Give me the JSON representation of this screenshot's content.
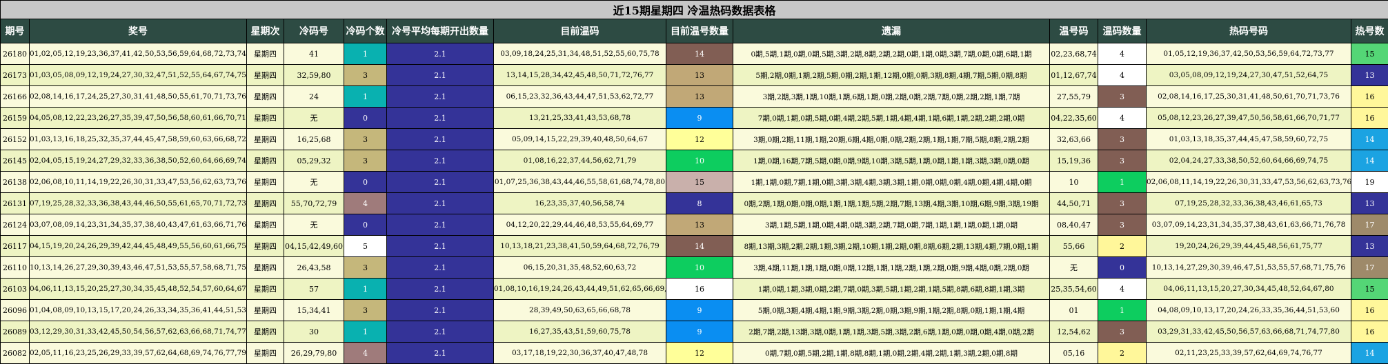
{
  "title": "近15期星期四 冷温热码数据表格",
  "headers": [
    "期号",
    "奖号",
    "星期次",
    "冷码号",
    "冷码个数",
    "冷号平均每期开出数量",
    "目前温码",
    "目前温号数量",
    "遗漏",
    "温号码",
    "温码数量",
    "热码号码",
    "热号数"
  ],
  "colors": {
    "avg": "#343398",
    "teal": "#09b1b0",
    "khaki": "#c5b77b",
    "navy": "#343398",
    "rose": "#9f7b7b",
    "white": "#ffffff",
    "brown": "#815e54",
    "tan": "#c1a877",
    "blue": "#0a8ef2",
    "yellow": "#ffff99",
    "green": "#0dcd5f",
    "pink": "#c9b0ab",
    "darkblue": "#343398",
    "lgreen": "#54d676",
    "skyblue": "#1ba3e2",
    "lyellow": "#fff79a",
    "taupe": "#9e8a6a"
  },
  "rows": [
    {
      "id": "26180",
      "nums": "01,02,05,12,19,23,36,37,41,42,50,53,56,59,64,68,72,73,74,77",
      "day": "星期四",
      "cold": "41",
      "cold_count": "1",
      "cold_color": "teal",
      "avg": "2.1",
      "warm": "03,09,18,24,25,31,34,48,51,52,55,60,75,78",
      "warm_count": "14",
      "warm_color": "brown",
      "miss": "0期,5期,1期,0期,0期,5期,3期,2期,8期,2期,2期,0期,1期,0期,3期,7期,0期,0期,6期,1期",
      "warm_nums": "02,23,68,74",
      "warm_num_count": "4",
      "warm_num_color": "white",
      "hot": "01,05,12,19,36,37,42,50,53,56,59,64,72,73,77",
      "hot_count": "15",
      "hot_color": "lgreen"
    },
    {
      "id": "26173",
      "nums": "01,03,05,08,09,12,19,24,27,30,32,47,51,52,55,64,67,74,75,80",
      "day": "星期四",
      "cold": "32,59,80",
      "cold_count": "3",
      "cold_color": "khaki",
      "avg": "2.1",
      "warm": "13,14,15,28,34,42,45,48,50,71,72,76,77",
      "warm_count": "13",
      "warm_color": "tan",
      "miss": "5期,2期,0期,1期,2期,5期,0期,2期,1期,12期,0期,0期,3期,8期,4期,7期,5期,0期,8期",
      "warm_nums": "01,12,67,74",
      "warm_num_count": "4",
      "warm_num_color": "white",
      "hot": "03,05,08,09,12,19,24,27,30,47,51,52,64,75",
      "hot_count": "13",
      "hot_color": "navy"
    },
    {
      "id": "26166",
      "nums": "02,08,14,16,17,24,25,27,30,31,41,48,50,55,61,70,71,73,76,79",
      "day": "星期四",
      "cold": "24",
      "cold_count": "1",
      "cold_color": "teal",
      "avg": "2.1",
      "warm": "06,15,23,32,36,43,44,47,51,53,62,72,77",
      "warm_count": "13",
      "warm_color": "tan",
      "miss": "3期,2期,3期,1期,10期,1期,6期,1期,0期,2期,0期,2期,7期,0期,2期,2期,1期,7期",
      "warm_nums": "27,55,79",
      "warm_num_count": "3",
      "warm_num_color": "brown",
      "hot": "02,08,14,16,17,25,30,31,41,48,50,61,70,71,73,76",
      "hot_count": "16",
      "hot_color": "lyellow"
    },
    {
      "id": "26159",
      "nums": "04,05,08,12,22,23,26,27,35,39,47,50,56,58,60,61,66,70,71,77",
      "day": "星期四",
      "cold": "无",
      "cold_count": "0",
      "cold_color": "navy",
      "avg": "2.1",
      "warm": "13,21,25,33,41,43,53,68,78",
      "warm_count": "9",
      "warm_color": "blue",
      "miss": "7期,0期,1期,0期,5期,0期,4期,2期,5期,1期,4期,4期,1期,6期,1期,2期,2期,2期,0期",
      "warm_nums": "04,22,35,60",
      "warm_num_count": "4",
      "warm_num_color": "white",
      "hot": "05,08,12,23,26,27,39,47,50,56,58,61,66,70,71,77",
      "hot_count": "16",
      "hot_color": "lyellow"
    },
    {
      "id": "26152",
      "nums": "01,03,13,16,18,25,32,35,37,44,45,47,58,59,60,63,66,68,72,75",
      "day": "星期四",
      "cold": "16,25,68",
      "cold_count": "3",
      "cold_color": "khaki",
      "avg": "2.1",
      "warm": "05,09,14,15,22,29,39,40,48,50,64,67",
      "warm_count": "12",
      "warm_color": "yellow",
      "miss": "3期,0期,2期,11期,1期,20期,6期,4期,0期,0期,2期,2期,1期,1期,7期,5期,8期,2期,2期",
      "warm_nums": "32,63,66",
      "warm_num_count": "3",
      "warm_num_color": "brown",
      "hot": "01,03,13,18,35,37,44,45,47,58,59,60,72,75",
      "hot_count": "14",
      "hot_color": "skyblue"
    },
    {
      "id": "26145",
      "nums": "02,04,05,15,19,24,27,29,32,33,36,38,50,52,60,64,66,69,74,75",
      "day": "星期四",
      "cold": "05,29,32",
      "cold_count": "3",
      "cold_color": "khaki",
      "avg": "2.1",
      "warm": "01,08,16,22,37,44,56,62,71,79",
      "warm_count": "10",
      "warm_color": "green",
      "miss": "1期,0期,16期,7期,5期,0期,0期,9期,10期,3期,5期,1期,0期,1期,1期,3期,3期,0期,0期",
      "warm_nums": "15,19,36",
      "warm_num_count": "3",
      "warm_num_color": "brown",
      "hot": "02,04,24,27,33,38,50,52,60,64,66,69,74,75",
      "hot_count": "14",
      "hot_color": "skyblue"
    },
    {
      "id": "26138",
      "nums": "02,06,08,10,11,14,19,22,26,30,31,33,47,53,56,62,63,73,76,77",
      "day": "星期四",
      "cold": "无",
      "cold_count": "0",
      "cold_color": "navy",
      "avg": "2.1",
      "warm": "01,07,25,36,38,43,44,46,55,58,61,68,74,78,80",
      "warm_count": "15",
      "warm_color": "pink",
      "miss": "1期,1期,0期,7期,1期,0期,3期,3期,4期,3期,3期,1期,0期,0期,0期,4期,0期,4期,4期,0期",
      "warm_nums": "10",
      "warm_num_count": "1",
      "warm_num_color": "green",
      "hot": "02,06,08,11,14,19,22,26,30,31,33,47,53,56,62,63,73,76,77",
      "hot_count": "19",
      "hot_color": "white"
    },
    {
      "id": "26131",
      "nums": "07,19,25,28,32,33,36,38,43,44,46,50,55,61,65,70,71,72,73,79",
      "day": "星期四",
      "cold": "55,70,72,79",
      "cold_count": "4",
      "cold_color": "rose",
      "avg": "2.1",
      "warm": "16,23,35,37,40,56,58,74",
      "warm_count": "8",
      "warm_color": "darkblue",
      "miss": "0期,2期,1期,0期,0期,0期,1期,1期,1期,5期,2期,7期,13期,4期,3期,10期,6期,9期,3期,19期",
      "warm_nums": "44,50,71",
      "warm_num_count": "3",
      "warm_num_color": "brown",
      "hot": "07,19,25,28,32,33,36,38,43,46,61,65,73",
      "hot_count": "13",
      "hot_color": "navy"
    },
    {
      "id": "26124",
      "nums": "03,07,08,09,14,23,31,34,35,37,38,40,43,47,61,63,66,71,76,78",
      "day": "星期四",
      "cold": "无",
      "cold_count": "0",
      "cold_color": "navy",
      "avg": "2.1",
      "warm": "04,12,20,22,29,44,46,48,53,55,64,69,77",
      "warm_count": "13",
      "warm_color": "tan",
      "miss": "3期,1期,5期,1期,0期,4期,0期,3期,2期,7期,0期,7期,1期,1期,1期,0期,1期,0期",
      "warm_nums": "08,40,47",
      "warm_num_count": "3",
      "warm_num_color": "brown",
      "hot": "03,07,09,14,23,31,34,35,37,38,43,61,63,66,71,76,78",
      "hot_count": "17",
      "hot_color": "taupe"
    },
    {
      "id": "26117",
      "nums": "04,15,19,20,24,26,29,39,42,44,45,48,49,55,56,60,61,66,75,77",
      "day": "星期四",
      "cold": "04,15,42,49,60",
      "cold_count": "5",
      "cold_color": "white",
      "avg": "2.1",
      "warm": "10,13,18,21,23,38,41,50,59,64,68,72,76,79",
      "warm_count": "14",
      "warm_color": "brown",
      "miss": "8期,13期,3期,2期,2期,1期,3期,2期,10期,1期,2期,0期,8期,6期,2期,13期,4期,7期,0期,1期",
      "warm_nums": "55,66",
      "warm_num_count": "2",
      "warm_num_color": "lyellow",
      "hot": "19,20,24,26,29,39,44,45,48,56,61,75,77",
      "hot_count": "13",
      "hot_color": "navy"
    },
    {
      "id": "26110",
      "nums": "10,13,14,26,27,29,30,39,43,46,47,51,53,55,57,58,68,71,75,76",
      "day": "星期四",
      "cold": "26,43,58",
      "cold_count": "3",
      "cold_color": "khaki",
      "avg": "2.1",
      "warm": "06,15,20,31,35,48,52,60,63,72",
      "warm_count": "10",
      "warm_color": "green",
      "miss": "3期,4期,11期,1期,1期,0期,0期,12期,1期,1期,2期,1期,2期,0期,9期,4期,0期,2期,0期",
      "warm_nums": "无",
      "warm_num_count": "0",
      "warm_num_color": "darkblue",
      "hot": "10,13,14,27,29,30,39,46,47,51,53,55,57,68,71,75,76",
      "hot_count": "17",
      "hot_color": "taupe"
    },
    {
      "id": "26103",
      "nums": "04,06,11,13,15,20,25,27,30,34,35,45,48,52,54,57,60,64,67,80",
      "day": "星期四",
      "cold": "57",
      "cold_count": "1",
      "cold_color": "teal",
      "avg": "2.1",
      "warm": "01,08,10,16,19,24,26,43,44,49,51,62,65,66,69,74",
      "warm_count": "16",
      "warm_color": "white",
      "miss": "1期,0期,1期,3期,0期,2期,7期,0期,3期,5期,1期,2期,1期,5期,8期,6期,8期,1期,3期",
      "warm_nums": "25,35,54,60",
      "warm_num_count": "4",
      "warm_num_color": "white",
      "hot": "04,06,11,13,15,20,27,30,34,45,48,52,64,67,80",
      "hot_count": "15",
      "hot_color": "lgreen"
    },
    {
      "id": "26096",
      "nums": "01,04,08,09,10,13,15,17,20,24,26,33,34,35,36,41,44,51,53,60",
      "day": "星期四",
      "cold": "15,34,41",
      "cold_count": "3",
      "cold_color": "khaki",
      "avg": "2.1",
      "warm": "28,39,49,50,63,65,66,68,78",
      "warm_count": "9",
      "warm_color": "blue",
      "miss": "5期,0期,3期,4期,4期,1期,9期,3期,2期,0期,3期,9期,1期,2期,8期,0期,1期,1期,4期",
      "warm_nums": "01",
      "warm_num_count": "1",
      "warm_num_color": "green",
      "hot": "04,08,09,10,13,17,20,24,26,33,35,36,44,51,53,60",
      "hot_count": "16",
      "hot_color": "lyellow"
    },
    {
      "id": "26089",
      "nums": "03,12,29,30,31,33,42,45,50,54,56,57,62,63,66,68,71,74,77,80",
      "day": "星期四",
      "cold": "30",
      "cold_count": "1",
      "cold_color": "teal",
      "avg": "2.1",
      "warm": "16,27,35,43,51,59,60,75,78",
      "warm_count": "9",
      "warm_color": "blue",
      "miss": "2期,7期,2期,13期,3期,0期,1期,1期,3期,5期,3期,2期,6期,1期,0期,0期,0期,4期,0期,2期",
      "warm_nums": "12,54,62",
      "warm_num_count": "3",
      "warm_num_color": "brown",
      "hot": "03,29,31,33,42,45,50,56,57,63,66,68,71,74,77,80",
      "hot_count": "16",
      "hot_color": "lyellow"
    },
    {
      "id": "26082",
      "nums": "02,05,11,16,23,25,26,29,33,39,57,62,64,68,69,74,76,77,79,80",
      "day": "星期四",
      "cold": "26,29,79,80",
      "cold_count": "4",
      "cold_color": "rose",
      "avg": "2.1",
      "warm": "03,17,18,19,22,30,36,37,40,47,48,78",
      "warm_count": "12",
      "warm_color": "yellow",
      "miss": "0期,7期,0期,5期,2期,1期,8期,8期,1期,0期,2期,4期,2期,1期,3期,2期,0期,8期",
      "warm_nums": "05,16",
      "warm_num_count": "2",
      "warm_num_color": "lyellow",
      "hot": "02,11,23,25,33,39,57,62,64,69,74,76,77",
      "hot_count": "14",
      "hot_color": "skyblue"
    }
  ]
}
